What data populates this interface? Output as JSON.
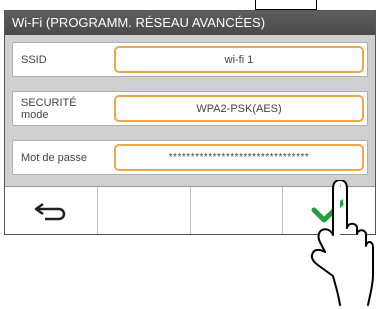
{
  "window": {
    "title": "Wi-Fi (PROGRAMM. RÉSEAU AVANCÉES)"
  },
  "fields": [
    {
      "label": "SSID",
      "value": "wi-fi 1"
    },
    {
      "label": "SECURITÉ\nmode",
      "value": "WPA2-PSK(AES)"
    },
    {
      "label": "Mot de passe",
      "value": "********************************"
    }
  ],
  "buttons": [
    {
      "icon": "back-arrow-icon"
    },
    {
      "icon": ""
    },
    {
      "icon": ""
    },
    {
      "icon": "checkmark-icon"
    }
  ],
  "colors": {
    "accent": "#f0a64a",
    "title_bar": "#555555",
    "check": "#22a03a",
    "panel": "#d0d0d0"
  }
}
